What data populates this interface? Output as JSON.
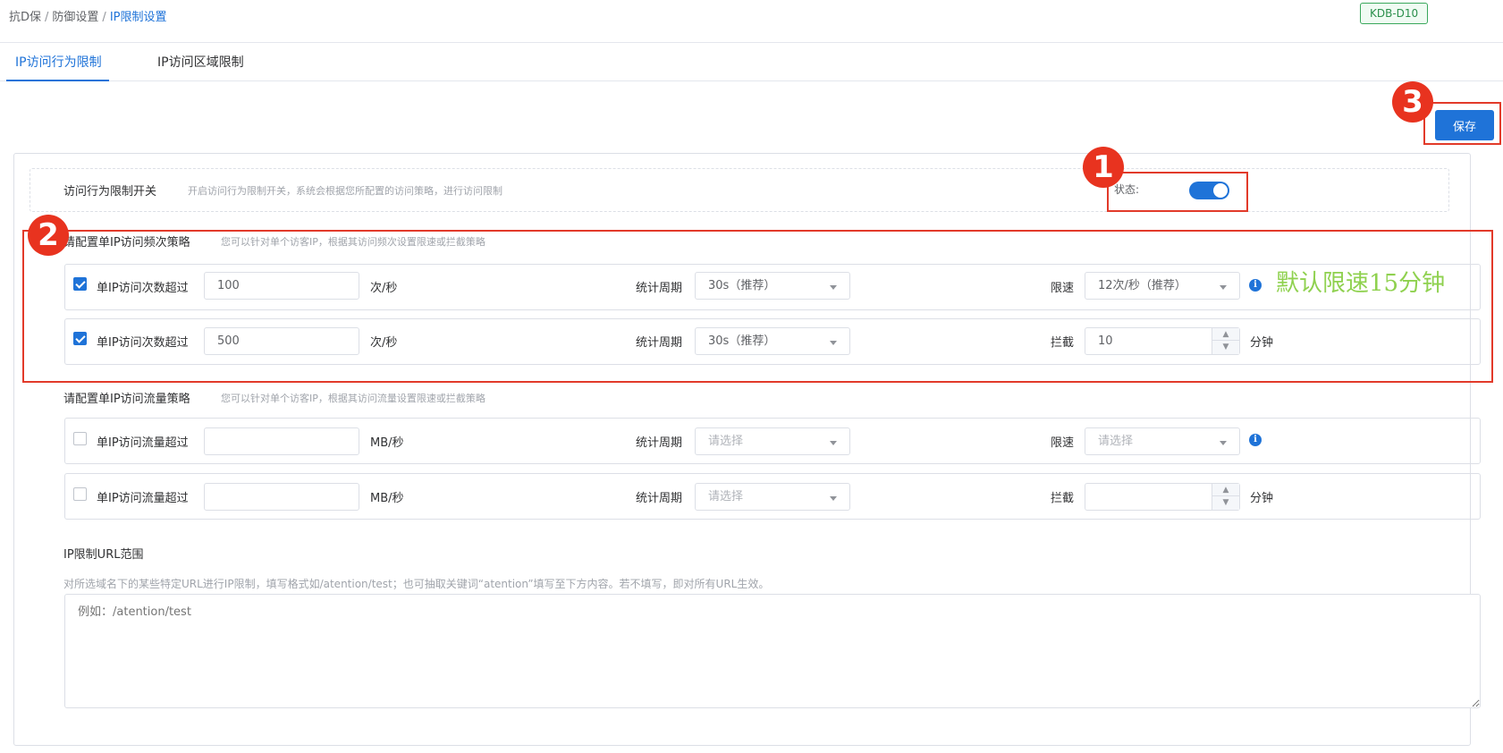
{
  "breadcrumb": {
    "items": [
      "抗D保",
      "防御设置"
    ],
    "current": "IP限制设置",
    "separator": "/"
  },
  "instance_tag": "KDB-D10",
  "tabs": [
    {
      "label": "IP访问行为限制",
      "active": true
    },
    {
      "label": "IP访问区域限制",
      "active": false
    }
  ],
  "save_label": "保存",
  "switch_section": {
    "title": "访问行为限制开关",
    "hint": "开启访问行为限制开关，系统会根据您所配置的访问策略，进行访问限制",
    "status_label": "状态:",
    "enabled": true
  },
  "frequency_section": {
    "title": "请配置单IP访问频次策略",
    "hint": "您可以针对单个访客IP，根据其访问频次设置限速或拦截策略",
    "rows": [
      {
        "checked": true,
        "label": "单IP访问次数超过",
        "value": "100",
        "unit": "次/秒",
        "period_label": "统计周期",
        "period_value": "30s（推荐）",
        "action_label": "限速",
        "action_value": "12次/秒（推荐）"
      },
      {
        "checked": true,
        "label": "单IP访问次数超过",
        "value": "500",
        "unit": "次/秒",
        "period_label": "统计周期",
        "period_value": "30s（推荐）",
        "action_label": "拦截",
        "action_value": "10",
        "action_unit": "分钟"
      }
    ]
  },
  "traffic_section": {
    "title": "请配置单IP访问流量策略",
    "hint": "您可以针对单个访客IP，根据其访问流量设置限速或拦截策略",
    "rows": [
      {
        "checked": false,
        "label": "单IP访问流量超过",
        "value": "",
        "unit": "MB/秒",
        "period_label": "统计周期",
        "period_placeholder": "请选择",
        "action_label": "限速",
        "action_placeholder": "请选择"
      },
      {
        "checked": false,
        "label": "单IP访问流量超过",
        "value": "",
        "unit": "MB/秒",
        "period_label": "统计周期",
        "period_placeholder": "请选择",
        "action_label": "拦截",
        "action_value": "",
        "action_unit": "分钟"
      }
    ]
  },
  "url_section": {
    "title": "IP限制URL范围",
    "hint": "对所选域名下的某些特定URL进行IP限制，填写格式如/atention/test；也可抽取关键词“atention”填写至下方内容。若不填写，即对所有URL生效。",
    "placeholder": "例如：/atention/test"
  },
  "annotations": {
    "badges": [
      "1",
      "2",
      "3"
    ],
    "note": "默认限速15分钟",
    "box_color": "#e23a2a",
    "note_color": "#8fd14f"
  },
  "colors": {
    "primary": "#1f73d8",
    "tag_green": "#3aa85c"
  }
}
